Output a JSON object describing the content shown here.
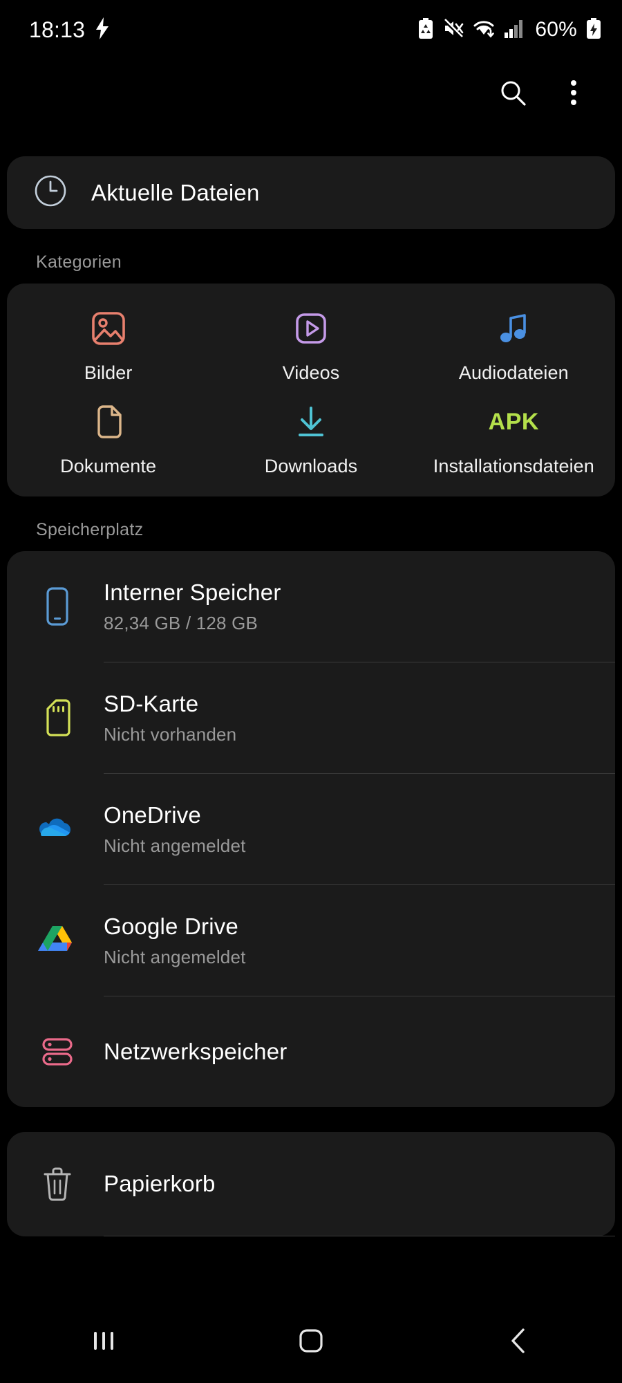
{
  "status_bar": {
    "time": "18:13",
    "charging_icon": "lightning-bolt-icon",
    "icons": [
      "battery-recycle-icon",
      "mute-icon",
      "wifi-icon",
      "signal-bars-icon"
    ],
    "battery_percent": "60%",
    "battery_icon": "battery-icon"
  },
  "app_bar": {
    "search_icon": "search-icon",
    "search_label": "Suchen",
    "more_icon": "more-options-icon",
    "more_label": "Weitere Optionen"
  },
  "recent": {
    "icon": "clock-icon",
    "label": "Aktuelle Dateien"
  },
  "categories": {
    "heading": "Kategorien",
    "items": [
      {
        "label": "Bilder",
        "icon": "image-icon",
        "color": "#e8806e"
      },
      {
        "label": "Videos",
        "icon": "video-icon",
        "color": "#c49ae8"
      },
      {
        "label": "Audiodateien",
        "icon": "music-note-icon",
        "color": "#4a90e2"
      },
      {
        "label": "Dokumente",
        "icon": "document-icon",
        "color": "#dcb68a"
      },
      {
        "label": "Downloads",
        "icon": "download-icon",
        "color": "#4fc3d4"
      },
      {
        "label": "Installationsdateien",
        "icon": "apk-icon",
        "color": "#b4e04b",
        "glyph": "APK"
      }
    ]
  },
  "storage": {
    "heading": "Speicherplatz",
    "items": [
      {
        "title": "Interner Speicher",
        "subtitle": "82,34 GB / 128 GB",
        "icon": "phone-icon",
        "color": "#5b9bd5"
      },
      {
        "title": "SD-Karte",
        "subtitle": "Nicht vorhanden",
        "icon": "sd-card-icon",
        "color": "#d4e157"
      },
      {
        "title": "OneDrive",
        "subtitle": "Nicht angemeldet",
        "icon": "onedrive-icon",
        "color": "#1a8fe3"
      },
      {
        "title": "Google Drive",
        "subtitle": "Nicht angemeldet",
        "icon": "google-drive-icon",
        "color": "#34a853"
      },
      {
        "title": "Netzwerkspeicher",
        "subtitle": "",
        "icon": "network-storage-icon",
        "color": "#ea6a8a"
      }
    ]
  },
  "trash": {
    "title": "Papierkorb",
    "icon": "trash-icon"
  },
  "nav_bar": {
    "recents_label": "Letzte Apps",
    "home_label": "Startbildschirm",
    "back_label": "Zurück"
  },
  "colors": {
    "background": "#000000",
    "card": "#1b1b1b",
    "primary_text": "#ffffff",
    "secondary_text": "#9a9a9a",
    "divider": "#3a3a3a"
  }
}
